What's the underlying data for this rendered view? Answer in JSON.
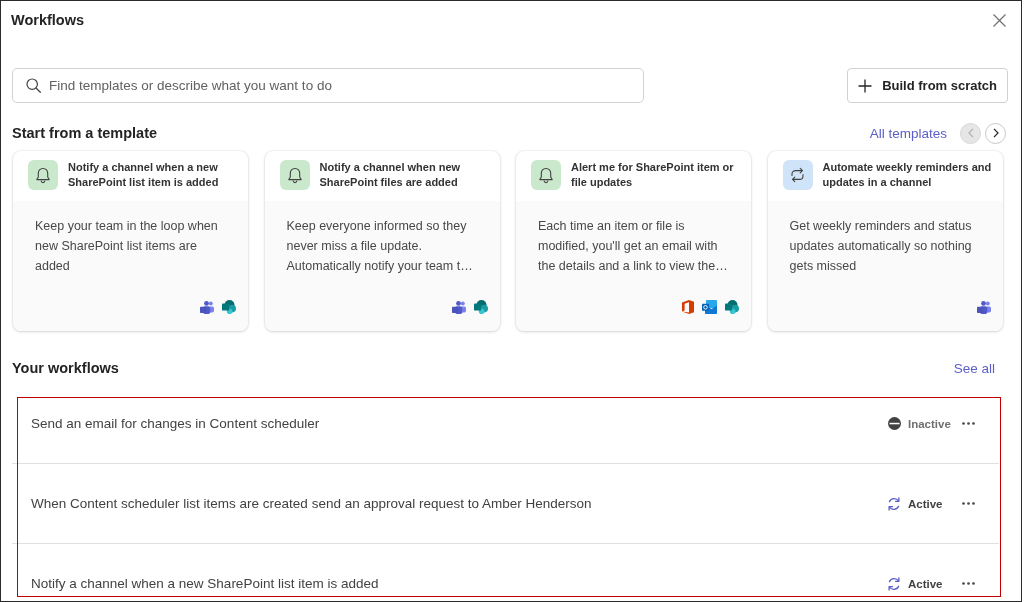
{
  "window": {
    "title": "Workflows"
  },
  "search": {
    "placeholder": "Find templates or describe what you want to do"
  },
  "build_button": {
    "label": "Build from scratch"
  },
  "templates": {
    "heading": "Start from a template",
    "link": "All templates",
    "nav_buttons": [
      {
        "kind": "previous",
        "disabled": true
      },
      {
        "kind": "next",
        "disabled": false
      }
    ],
    "cards": [
      {
        "kind": "alert",
        "title": "Notify a channel when a new SharePoint list item is added",
        "description": "Keep your team in the loop when new SharePoint list items are added",
        "app_icons": [
          {
            "kind": "people"
          },
          {
            "kind": "circles"
          }
        ]
      },
      {
        "kind": "alert",
        "title": "Notify a channel when new SharePoint files are added",
        "description": "Keep everyone informed so they never miss a file update. Automatically notify your team t…",
        "app_icons": [
          {
            "kind": "people"
          },
          {
            "kind": "circles"
          }
        ]
      },
      {
        "kind": "alert",
        "title": "Alert me for SharePoint item or file updates",
        "description": "Each time an item or file is modified, you'll get an email with the details and a link to view the…",
        "app_icons": [
          {
            "kind": "bracket"
          },
          {
            "kind": "envelope"
          },
          {
            "kind": "circles"
          }
        ]
      },
      {
        "kind": "recurring",
        "title": "Automate weekly reminders and updates in a channel",
        "description": "Get weekly reminders and status updates automatically so nothing gets missed",
        "app_icons": [
          {
            "kind": "people"
          }
        ]
      }
    ]
  },
  "workflows": {
    "heading": "Your workflows",
    "link": "See all",
    "items": [
      {
        "title": "Send an email for changes in Content scheduler",
        "status": "Inactive",
        "active": false
      },
      {
        "title": "When Content scheduler list items are created send an approval request to Amber Henderson",
        "status": "Active",
        "active": true
      },
      {
        "title": "Notify a channel when a new SharePoint list item is added",
        "status": "Active",
        "active": true
      }
    ]
  }
}
